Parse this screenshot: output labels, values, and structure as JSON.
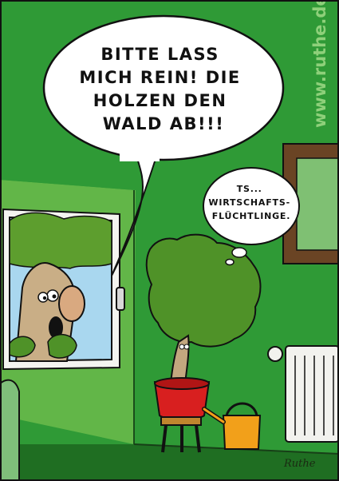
{
  "speech_bubble": {
    "lines": [
      "BITTE LASS",
      "MICH REIN! DIE",
      "HOLZEN DEN",
      "WALD AB!!!"
    ]
  },
  "thought_bubble": {
    "lines": [
      "TS...",
      "WIRTSCHAFTS-",
      "FLÜCHTLINGE."
    ]
  },
  "watermark": "www.ruthe.de",
  "signature": "Ruthe",
  "colors": {
    "wall_dark": "#2f9a36",
    "wall_light": "#6bbf4a",
    "floor": "#1f6e22",
    "sky": "#a9d7ef",
    "pot": "#d81f1f",
    "watering_can": "#f2a01a",
    "foliage": "#4f9228",
    "bark": "#c3a77f"
  }
}
